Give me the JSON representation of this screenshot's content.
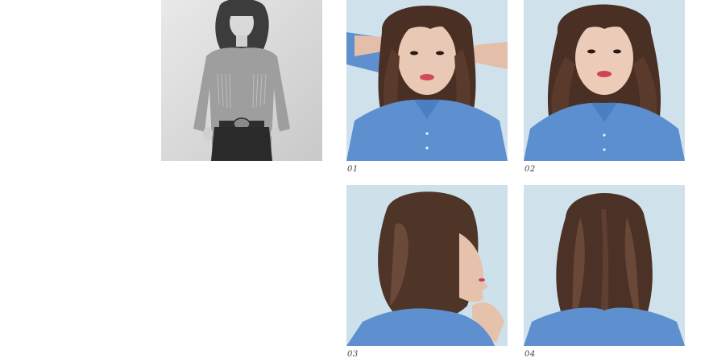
{
  "gallery": {
    "hero": {
      "alt": ""
    },
    "photos": [
      {
        "caption": "01"
      },
      {
        "caption": "02"
      },
      {
        "caption": "03"
      },
      {
        "caption": "04"
      }
    ]
  },
  "colors": {
    "background": "#ffffff",
    "caption_text": "#444444",
    "backdrop_blue": "#cfe2ec",
    "shirt_blue": "#5e90cf",
    "hair_brown": "#4a2f24",
    "skin": "#e9c9b6",
    "hero_gray": "#d8d8d8"
  }
}
